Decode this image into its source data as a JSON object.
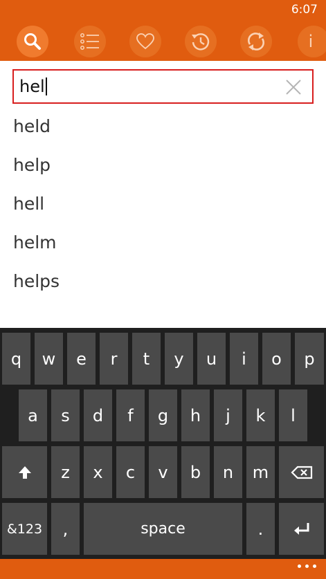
{
  "status": {
    "time": "6:07"
  },
  "toolbar": {
    "buttons": [
      {
        "icon": "search-icon",
        "active": true
      },
      {
        "icon": "list-icon",
        "active": false
      },
      {
        "icon": "heart-icon",
        "active": false
      },
      {
        "icon": "history-icon",
        "active": false
      },
      {
        "icon": "refresh-icon",
        "active": false
      },
      {
        "icon": "info-icon",
        "active": false
      }
    ],
    "info_glyph": "i"
  },
  "search": {
    "value": "hel",
    "placeholder": ""
  },
  "suggestions": [
    "held",
    "help",
    "hell",
    "helm",
    "helps"
  ],
  "keyboard": {
    "row1": [
      "q",
      "w",
      "e",
      "r",
      "t",
      "y",
      "u",
      "i",
      "o",
      "p"
    ],
    "row2": [
      "a",
      "s",
      "d",
      "f",
      "g",
      "h",
      "j",
      "k",
      "l"
    ],
    "row3": [
      "z",
      "x",
      "c",
      "v",
      "b",
      "n",
      "m"
    ],
    "symbols_label": "&123",
    "comma_label": ",",
    "space_label": "space",
    "period_label": "."
  },
  "colors": {
    "accent": "#e05c0f",
    "search_border": "#d81e1e",
    "key_bg": "#4a4a4a",
    "keyboard_bg": "#1f1f1f"
  }
}
